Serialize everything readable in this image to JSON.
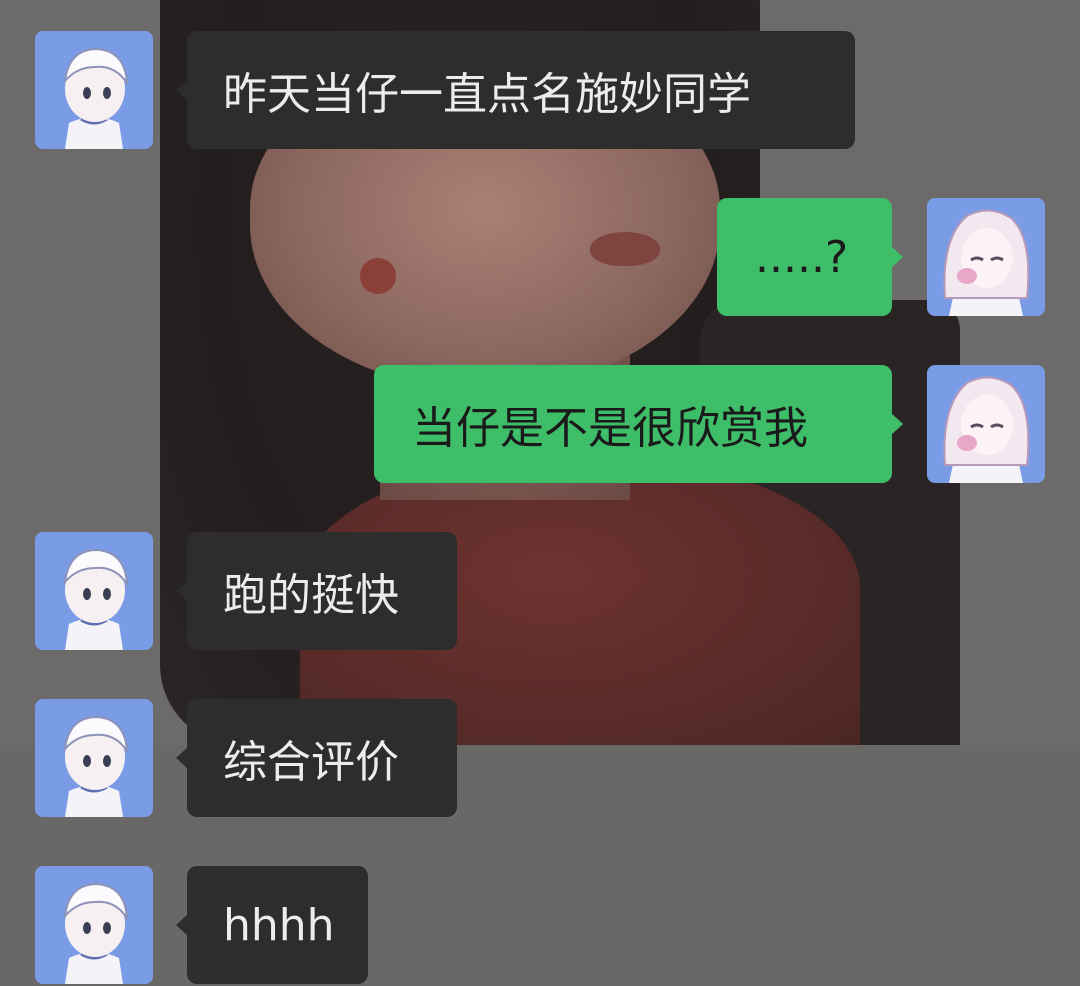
{
  "messages": [
    {
      "side": "in",
      "text": "昨天当仔一直点名施妙同学",
      "avatar": "boy-avatar"
    },
    {
      "side": "out",
      "text": ".....?",
      "avatar": "girl-avatar"
    },
    {
      "side": "out",
      "text": "当仔是不是很欣赏我",
      "avatar": "girl-avatar"
    },
    {
      "side": "in",
      "text": "跑的挺快",
      "avatar": "boy-avatar"
    },
    {
      "side": "in",
      "text": "综合评价",
      "avatar": "boy-avatar"
    },
    {
      "side": "in",
      "text": "hhhh",
      "avatar": "boy-avatar"
    }
  ],
  "colors": {
    "incoming_bubble": "#2d2d2d",
    "outgoing_bubble": "#3fbe6a",
    "avatar_bg": "#7a9ce6"
  }
}
